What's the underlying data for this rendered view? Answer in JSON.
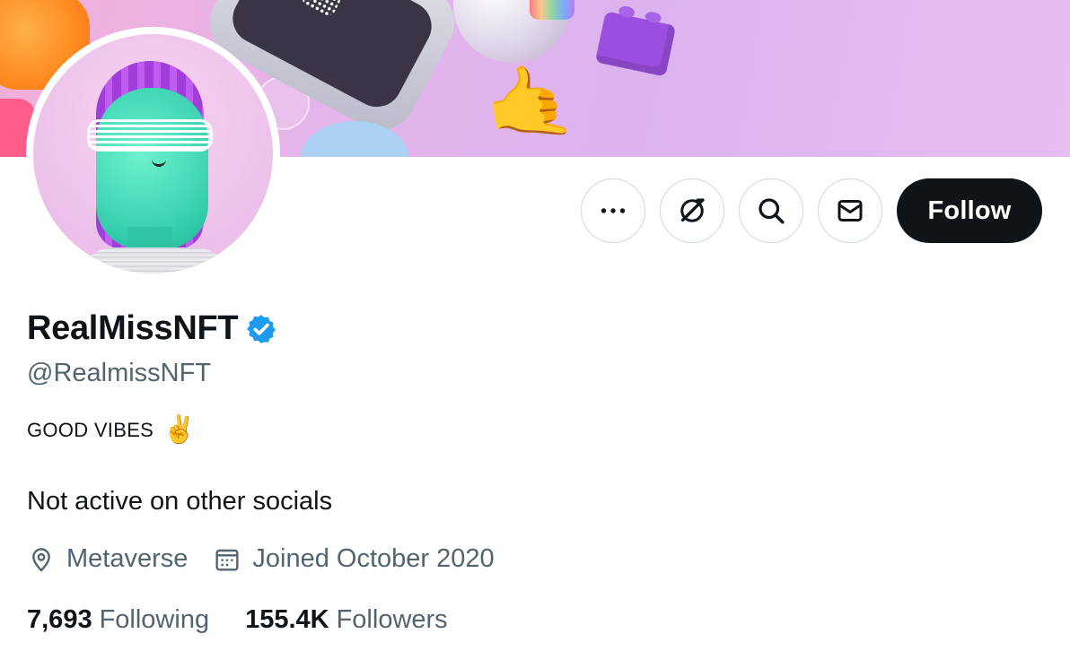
{
  "profile": {
    "display_name": "RealMissNFT",
    "handle": "@RealmissNFT",
    "verified": true,
    "bio_line_1": "GOOD VIBES",
    "bio_emoji": "✌️",
    "bio_line_2": "Not active on other socials",
    "location": "Metaverse",
    "joined": "Joined October 2020"
  },
  "stats": {
    "following_count": "7,693",
    "following_label": "Following",
    "followers_count": "155.4K",
    "followers_label": "Followers"
  },
  "actions": {
    "more_icon": "more-horizontal-icon",
    "grok_icon": "grok-icon",
    "search_icon": "search-icon",
    "message_icon": "envelope-icon",
    "follow_label": "Follow"
  },
  "colors": {
    "accent_verified": "#1d9bf0",
    "follow_button_bg": "#0f1419",
    "secondary_text": "#536471",
    "banner": "#e0b3ee"
  }
}
